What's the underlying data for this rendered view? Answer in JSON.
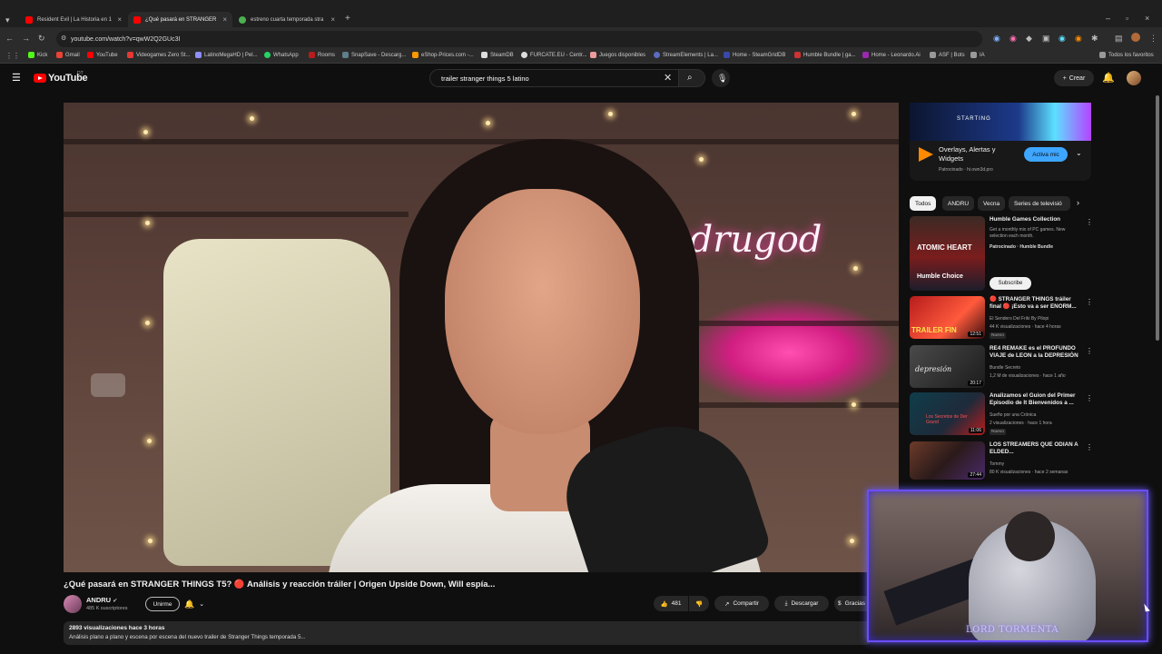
{
  "browser": {
    "tabs": [
      {
        "title": "Resident Evil | La Historia en 1",
        "active": false,
        "color": "#ff0000"
      },
      {
        "title": "¿Qué pasará en STRANGER",
        "active": true,
        "color": "#ff0000"
      },
      {
        "title": "estreno cuarta temporada stra",
        "active": false,
        "color": "#4caf50"
      }
    ],
    "new_tab": "+",
    "url": "youtube.com/watch?v=qwW2Q2GUc3I",
    "bookmarks": [
      "Kick",
      "Gmail",
      "YouTube",
      "Videogames Zero St...",
      "LatinoMegaHD | Pel...",
      "WhatsApp",
      "Rooms",
      "SnapSave - Descarg...",
      "eShop-Prices.com -...",
      "SteamDB",
      "FURCATE.EU - Centr...",
      "Juegos disponibles",
      "StreamElements | La...",
      "Home - SteamGridDB",
      "Humble Bundle | ga...",
      "Home - Leonardo.Ai",
      "ASF | Bots",
      "IA"
    ],
    "all_bookmarks": "Todos los favoritos"
  },
  "youtube": {
    "logo": "YouTube",
    "country": "DT",
    "search_query": "trailer stranger things 5 latino",
    "create_label": "Crear",
    "player": {
      "neon_sign": "andrugod"
    },
    "video": {
      "title": "¿Qué pasará en STRANGER THINGS T5? 🔴 Análisis y reacción tráiler | Origen Upside Down, Will espía...",
      "channel": "ANDRU",
      "subscribers": "485 K suscriptores",
      "join_label": "Unirme",
      "likes": "481",
      "share_label": "Compartir",
      "download_label": "Descargar",
      "thanks_label": "Gracias",
      "stats": "2893 visualizaciones  hace 3 horas",
      "description": "Análisis plano a plano y escena por escena del nuevo trailer de Stranger Things temporada 5..."
    },
    "ad": {
      "banner_text": "STARTING",
      "title": "Overlays, Alertas y Widgets",
      "sponsor": "Patrocinado · hi.own3d.pro",
      "cta": "Activa mic"
    },
    "chips": [
      "Todos",
      "ANDRU",
      "Vecna",
      "Series de televisió"
    ],
    "recommendations": [
      {
        "title": "Humble Games Collection",
        "channel": "Get a monthly mix of PC games. New selection each month.",
        "meta": "Patrocinado · Humble Bundle",
        "thumb_text": "ATOMIC HEART",
        "thumb_sub": "Humble Choice",
        "subscribe": "Subscribe",
        "duration": ""
      },
      {
        "title": "🔴 STRANGER THINGS tráiler final 🔴 ¡Esto va a ser ENORM...",
        "channel": "El Sendero Del Friki By Pilopi",
        "meta": "44 K visualizaciones · hace 4 horas",
        "badge": "Nuevo",
        "thumb_text": "TRAILER FIN",
        "duration": "12:51"
      },
      {
        "title": "RE4 REMAKE es el PROFUNDO VIAJE de LEON a la DEPRESIÓN",
        "channel": "Bundle Secreto",
        "meta": "1,2 M de visualizaciones · hace 1 año",
        "thumb_text": "depresión",
        "duration": "20:17"
      },
      {
        "title": "Analizamos el Guion del Primer Episodio de It Bienvenidos a ...",
        "channel": "Sueño por una Crónica",
        "meta": "2 visualizaciones · hace 1 hora",
        "badge": "Nuevo",
        "thumb_text": "Los Secretos de Der Grund",
        "duration": "11:06"
      },
      {
        "title": "LOS STREAMERS QUE ODIAN A ELDED...",
        "channel": "Tommy",
        "meta": "80 K visualizaciones · hace 2 semanas",
        "thumb_text": "",
        "duration": "27:44"
      }
    ]
  },
  "overlay": {
    "cam_label": "LORD TORMENTA"
  },
  "colors": {
    "yt_red": "#ff0000",
    "accent_blue": "#3ea6ff",
    "cam_border": "#6b4dff"
  }
}
